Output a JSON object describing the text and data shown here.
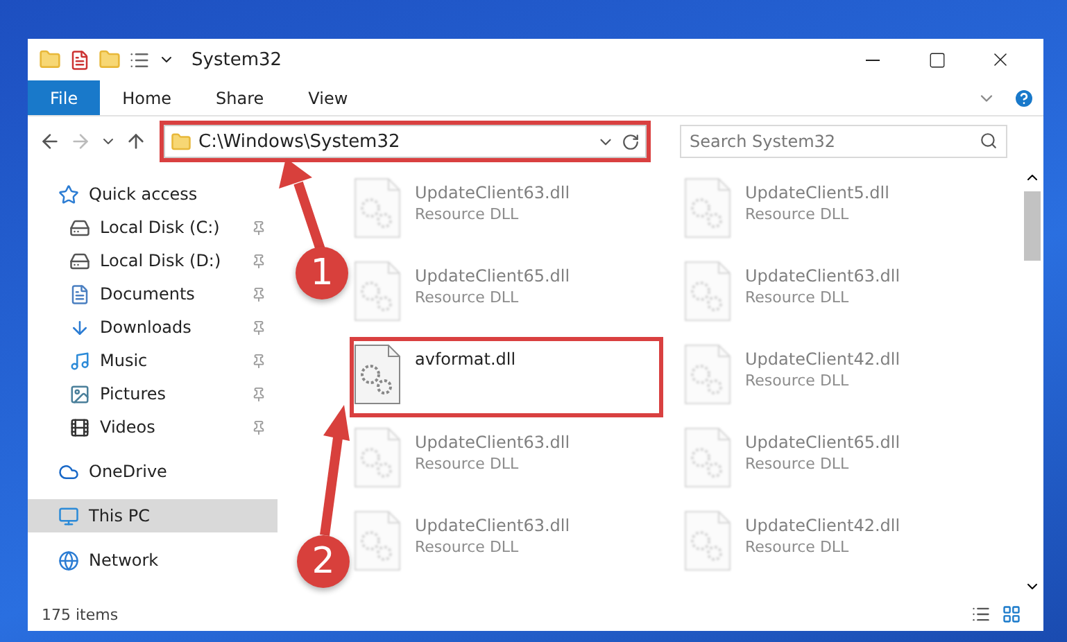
{
  "window": {
    "title": "System32"
  },
  "ribbon_tabs": [
    {
      "label": "File",
      "selected": true
    },
    {
      "label": "Home",
      "selected": false
    },
    {
      "label": "Share",
      "selected": false
    },
    {
      "label": "View",
      "selected": false
    }
  ],
  "address": {
    "path": "C:\\Windows\\System32",
    "highlighted": true
  },
  "search": {
    "placeholder": "Search System32"
  },
  "sidebar": {
    "items": [
      {
        "label": "Quick access",
        "kind": "star",
        "selected": false,
        "pinned": false,
        "children": [
          {
            "label": "Local Disk (C:)",
            "kind": "drive",
            "selected": false,
            "pinned": true
          },
          {
            "label": "Local Disk (D:)",
            "kind": "drive",
            "selected": false,
            "pinned": true
          },
          {
            "label": "Documents",
            "kind": "docs",
            "selected": false,
            "pinned": true
          },
          {
            "label": "Downloads",
            "kind": "download",
            "selected": false,
            "pinned": true
          },
          {
            "label": "Music",
            "kind": "music",
            "selected": false,
            "pinned": true
          },
          {
            "label": "Pictures",
            "kind": "pictures",
            "selected": false,
            "pinned": true
          },
          {
            "label": "Videos",
            "kind": "videos",
            "selected": false,
            "pinned": true
          }
        ]
      },
      {
        "label": "OneDrive",
        "kind": "cloud",
        "selected": false,
        "pinned": false
      },
      {
        "label": "This PC",
        "kind": "pc",
        "selected": true,
        "pinned": false
      },
      {
        "label": "Network",
        "kind": "network",
        "selected": false,
        "pinned": false
      }
    ]
  },
  "files": [
    {
      "name": "UpdateClient63.dll",
      "type": "Resource DLL",
      "dimmed": true,
      "highlighted": false
    },
    {
      "name": "UpdateClient5.dll",
      "type": "Resource DLL",
      "dimmed": true,
      "highlighted": false
    },
    {
      "name": "UpdateClient65.dll",
      "type": "Resource DLL",
      "dimmed": true,
      "highlighted": false
    },
    {
      "name": "UpdateClient63.dll",
      "type": "Resource DLL",
      "dimmed": true,
      "highlighted": false
    },
    {
      "name": "avformat.dll",
      "dimmed": false,
      "highlighted": true
    },
    {
      "name": "UpdateClient42.dll",
      "type": "Resource DLL",
      "dimmed": true,
      "highlighted": false
    },
    {
      "name": "UpdateClient63.dll",
      "type": "Resource DLL",
      "dimmed": true,
      "highlighted": false
    },
    {
      "name": "UpdateClient65.dll",
      "type": "Resource DLL",
      "dimmed": true,
      "highlighted": false
    },
    {
      "name": "UpdateClient63.dll",
      "type": "Resource DLL",
      "dimmed": true,
      "highlighted": false
    },
    {
      "name": "UpdateClient42.dll",
      "type": "Resource DLL",
      "dimmed": true,
      "highlighted": false
    }
  ],
  "status_bar": {
    "count": "175 items"
  },
  "callouts": [
    {
      "number": "1"
    },
    {
      "number": "2"
    }
  ]
}
